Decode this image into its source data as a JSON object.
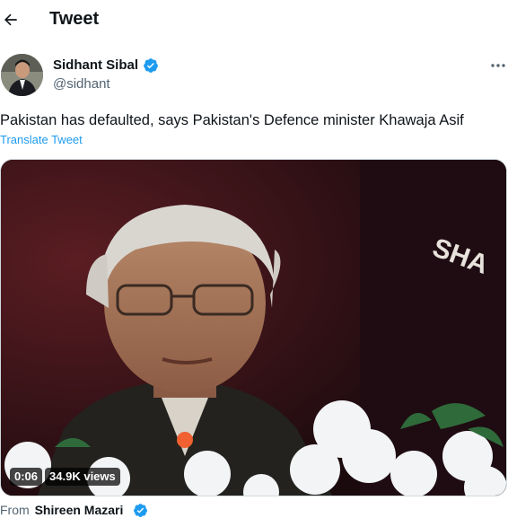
{
  "header": {
    "title": "Tweet"
  },
  "author": {
    "name": "Sidhant Sibal",
    "handle": "@sidhant"
  },
  "tweet": {
    "text": "Pakistan has defaulted, says Pakistan's Defence minister Khawaja Asif",
    "translate_label": "Translate Tweet"
  },
  "video": {
    "duration": "0:06",
    "views": "34.9K views",
    "banner_text": "SHA"
  },
  "source": {
    "prefix": "From",
    "name": "Shireen Mazari"
  },
  "colors": {
    "accent": "#1d9bf0",
    "text": "#0f1419",
    "muted": "#536471"
  }
}
